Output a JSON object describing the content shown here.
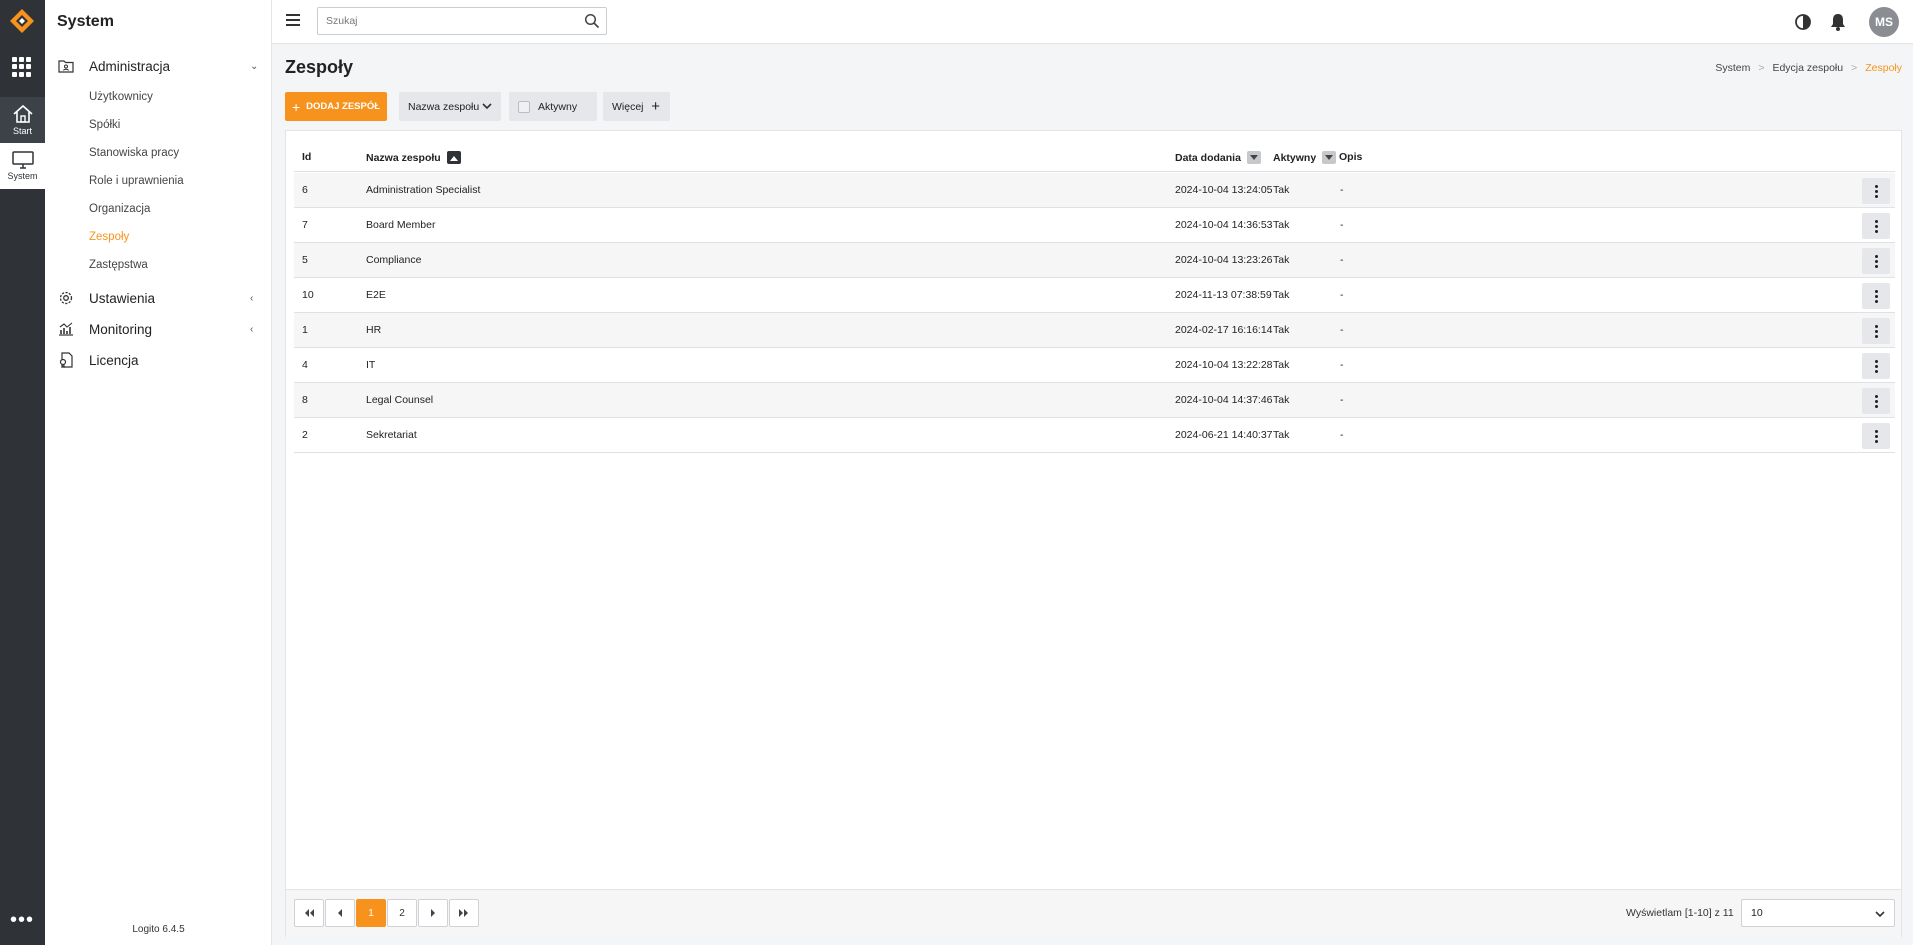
{
  "rail": {
    "start_label": "Start",
    "system_label": "System",
    "more_label": "•••"
  },
  "sidebar": {
    "title": "System",
    "groups": [
      {
        "label": "Administracja",
        "chevron": "⌄",
        "icon": "folder-user-icon"
      },
      {
        "label": "Ustawienia",
        "chevron": "‹",
        "icon": "gear-icon"
      },
      {
        "label": "Monitoring",
        "chevron": "‹",
        "icon": "chart-icon"
      },
      {
        "label": "Licencja",
        "icon": "license-icon"
      }
    ],
    "admin_items": [
      {
        "label": "Użytkownicy"
      },
      {
        "label": "Spółki"
      },
      {
        "label": "Stanowiska pracy"
      },
      {
        "label": "Role i uprawnienia"
      },
      {
        "label": "Organizacja"
      },
      {
        "label": "Zespoły",
        "active": true
      },
      {
        "label": "Zastępstwa"
      }
    ],
    "version": "Logito 6.4.5"
  },
  "topbar": {
    "search_placeholder": "Szukaj",
    "avatar_initials": "MS"
  },
  "page": {
    "title": "Zespoły",
    "breadcrumb": [
      "System",
      "Edycja zespołu",
      "Zespoły"
    ],
    "breadcrumb_sep": ">"
  },
  "toolbar": {
    "add_label": "DODAJ ZESPÓŁ",
    "name_filter_label": "Nazwa zespołu",
    "active_filter_label": "Aktywny",
    "more_label": "Więcej"
  },
  "table": {
    "columns": {
      "id": "Id",
      "name": "Nazwa zespołu",
      "date": "Data dodania",
      "active": "Aktywny",
      "desc": "Opis"
    },
    "rows": [
      {
        "id": "6",
        "name": "Administration Specialist",
        "date": "2024-10-04 13:24:05",
        "active": "Tak",
        "desc": "-"
      },
      {
        "id": "7",
        "name": "Board Member",
        "date": "2024-10-04 14:36:53",
        "active": "Tak",
        "desc": "-"
      },
      {
        "id": "5",
        "name": "Compliance",
        "date": "2024-10-04 13:23:26",
        "active": "Tak",
        "desc": "-"
      },
      {
        "id": "10",
        "name": "E2E",
        "date": "2024-11-13 07:38:59",
        "active": "Tak",
        "desc": "-"
      },
      {
        "id": "1",
        "name": "HR",
        "date": "2024-02-17 16:16:14",
        "active": "Tak",
        "desc": "-"
      },
      {
        "id": "4",
        "name": "IT",
        "date": "2024-10-04 13:22:28",
        "active": "Tak",
        "desc": "-"
      },
      {
        "id": "8",
        "name": "Legal Counsel",
        "date": "2024-10-04 14:37:46",
        "active": "Tak",
        "desc": "-"
      },
      {
        "id": "2",
        "name": "Sekretariat",
        "date": "2024-06-21 14:40:37",
        "active": "Tak",
        "desc": "-"
      }
    ]
  },
  "pagination": {
    "pages": [
      "1",
      "2"
    ],
    "current_page": "1",
    "showing": "Wyświetlam [1-10] z 11",
    "page_size": "10"
  },
  "colors": {
    "accent": "#f7931d",
    "rail": "#2f3338"
  }
}
